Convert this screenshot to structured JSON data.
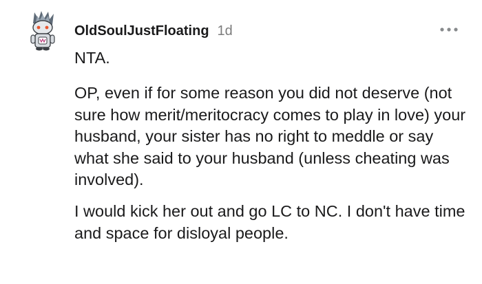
{
  "comment": {
    "author": "OldSoulJustFloating",
    "timestamp": "1d",
    "more_icon": "more-options-icon",
    "avatar_icon": "snoo-avatar-icon",
    "paragraphs": [
      "NTA.",
      "OP, even if for some reason you did not deserve (not sure how merit/meritocracy comes to play in love) your husband, your sister has no right to meddle or say what she said to your husband (unless cheating was involved).",
      "I would kick her out and go LC to NC. I don't have time and space for disloyal people."
    ]
  },
  "colors": {
    "text": "#1a1a1b",
    "meta": "#7c7c7c",
    "background": "#ffffff"
  }
}
